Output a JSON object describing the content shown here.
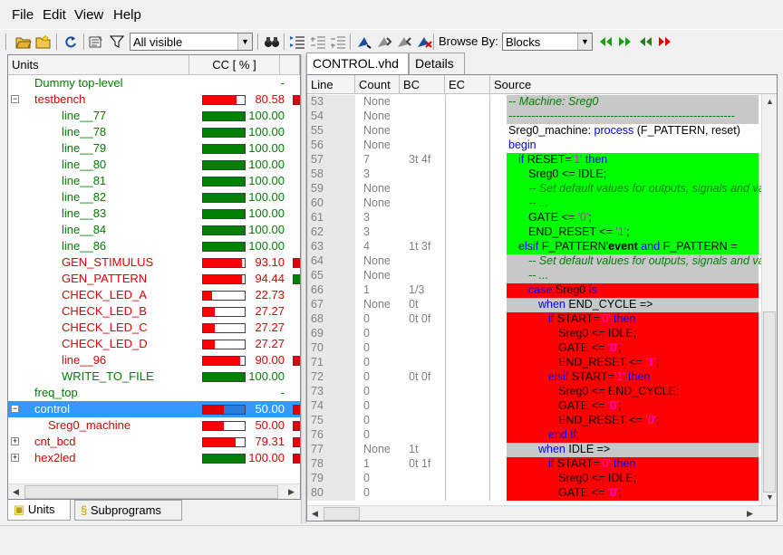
{
  "menu": [
    "File",
    "Edit",
    "View",
    "Help"
  ],
  "toolbar": {
    "filter_value": "All visible",
    "browse_by_label": "Browse By:",
    "browse_by_value": "Blocks"
  },
  "left": {
    "col_units": "Units",
    "col_cc": "CC [ % ]",
    "rows": [
      {
        "name": "Dummy top-level",
        "indent": 0,
        "expander": "",
        "color": "green",
        "pct": "-",
        "fill": 0,
        "fill_color": "",
        "mini": ""
      },
      {
        "name": "testbench",
        "indent": 0,
        "expander": "-",
        "color": "red",
        "pct": "80.58",
        "fill": 0.8058,
        "fill_color": "red",
        "mini": "#e00000"
      },
      {
        "name": "line__77",
        "indent": 2,
        "expander": "",
        "color": "green",
        "pct": "100.00",
        "fill": 1,
        "fill_color": "green",
        "mini": ""
      },
      {
        "name": "line__78",
        "indent": 2,
        "expander": "",
        "color": "green",
        "pct": "100.00",
        "fill": 1,
        "fill_color": "green",
        "mini": ""
      },
      {
        "name": "line__79",
        "indent": 2,
        "expander": "",
        "color": "green",
        "pct": "100.00",
        "fill": 1,
        "fill_color": "green",
        "mini": ""
      },
      {
        "name": "line__80",
        "indent": 2,
        "expander": "",
        "color": "green",
        "pct": "100.00",
        "fill": 1,
        "fill_color": "green",
        "mini": ""
      },
      {
        "name": "line__81",
        "indent": 2,
        "expander": "",
        "color": "green",
        "pct": "100.00",
        "fill": 1,
        "fill_color": "green",
        "mini": ""
      },
      {
        "name": "line__82",
        "indent": 2,
        "expander": "",
        "color": "green",
        "pct": "100.00",
        "fill": 1,
        "fill_color": "green",
        "mini": ""
      },
      {
        "name": "line__83",
        "indent": 2,
        "expander": "",
        "color": "green",
        "pct": "100.00",
        "fill": 1,
        "fill_color": "green",
        "mini": ""
      },
      {
        "name": "line__84",
        "indent": 2,
        "expander": "",
        "color": "green",
        "pct": "100.00",
        "fill": 1,
        "fill_color": "green",
        "mini": ""
      },
      {
        "name": "line__86",
        "indent": 2,
        "expander": "",
        "color": "green",
        "pct": "100.00",
        "fill": 1,
        "fill_color": "green",
        "mini": ""
      },
      {
        "name": "GEN_STIMULUS",
        "indent": 2,
        "expander": "",
        "color": "red",
        "pct": "93.10",
        "fill": 0.931,
        "fill_color": "red",
        "mini": "#e00000"
      },
      {
        "name": "GEN_PATTERN",
        "indent": 2,
        "expander": "",
        "color": "red",
        "pct": "94.44",
        "fill": 0.9444,
        "fill_color": "red",
        "mini": "#008000"
      },
      {
        "name": "CHECK_LED_A",
        "indent": 2,
        "expander": "",
        "color": "red",
        "pct": "22.73",
        "fill": 0.2273,
        "fill_color": "red",
        "mini": ""
      },
      {
        "name": "CHECK_LED_B",
        "indent": 2,
        "expander": "",
        "color": "red",
        "pct": "27.27",
        "fill": 0.2727,
        "fill_color": "red",
        "mini": ""
      },
      {
        "name": "CHECK_LED_C",
        "indent": 2,
        "expander": "",
        "color": "red",
        "pct": "27.27",
        "fill": 0.2727,
        "fill_color": "red",
        "mini": ""
      },
      {
        "name": "CHECK_LED_D",
        "indent": 2,
        "expander": "",
        "color": "red",
        "pct": "27.27",
        "fill": 0.2727,
        "fill_color": "red",
        "mini": ""
      },
      {
        "name": "line__96",
        "indent": 2,
        "expander": "",
        "color": "red",
        "pct": "90.00",
        "fill": 0.9,
        "fill_color": "red",
        "mini": "#e00000"
      },
      {
        "name": "WRITE_TO_FILE",
        "indent": 2,
        "expander": "",
        "color": "green",
        "pct": "100.00",
        "fill": 1,
        "fill_color": "green",
        "mini": ""
      },
      {
        "name": "freq_top",
        "indent": 0,
        "expander": "",
        "color": "green",
        "pct": "-",
        "fill": 0,
        "fill_color": "",
        "mini": ""
      },
      {
        "name": "control",
        "indent": 0,
        "expander": "-",
        "color": "red",
        "pct": "50.00",
        "fill": 0.5,
        "fill_color": "red",
        "mini": "#e00000",
        "selected": true
      },
      {
        "name": "Sreg0_machine",
        "indent": 1,
        "expander": "",
        "color": "red",
        "pct": "50.00",
        "fill": 0.5,
        "fill_color": "red",
        "mini": "#e00000"
      },
      {
        "name": "cnt_bcd",
        "indent": 0,
        "expander": "+",
        "color": "red",
        "pct": "79.31",
        "fill": 0.7931,
        "fill_color": "red",
        "mini": "#e00000"
      },
      {
        "name": "hex2led",
        "indent": 0,
        "expander": "+",
        "color": "red",
        "pct": "100.00",
        "fill": 1,
        "fill_color": "green",
        "mini": "#e00000"
      }
    ],
    "tabs": [
      "Units",
      "Subprograms"
    ]
  },
  "right": {
    "tabs": [
      "CONTROL.vhd",
      "Details"
    ],
    "headers": {
      "line": "Line",
      "count": "Count",
      "bc": "BC",
      "ec": "EC",
      "source": "Source"
    },
    "rows": [
      {
        "line": "53",
        "count": "None",
        "bc": "",
        "bg": "gray",
        "indent": 0,
        "parts": [
          {
            "t": "-- Machine: Sreg0",
            "c": "cmt"
          }
        ]
      },
      {
        "line": "54",
        "count": "None",
        "bc": "",
        "bg": "gray",
        "indent": 0,
        "parts": [
          {
            "t": "------------------------------------------------------------",
            "c": "cmt"
          }
        ]
      },
      {
        "line": "55",
        "count": "None",
        "bc": "",
        "bg": "white",
        "indent": 0,
        "parts": [
          {
            "t": "Sreg0_machine: ",
            "c": "n"
          },
          {
            "t": "process",
            "c": "kw"
          },
          {
            "t": " (F_PATTERN, reset)",
            "c": "n"
          }
        ]
      },
      {
        "line": "56",
        "count": "None",
        "bc": "",
        "bg": "white",
        "indent": 0,
        "parts": [
          {
            "t": "begin",
            "c": "kw"
          }
        ]
      },
      {
        "line": "57",
        "count": "7",
        "bc": "3t 4f",
        "bg": "green",
        "indent": 1,
        "parts": [
          {
            "t": "if",
            "c": "kw"
          },
          {
            "t": " RESET=",
            "c": "n"
          },
          {
            "t": "'1'",
            "c": "str"
          },
          {
            "t": " then",
            "c": "kw"
          }
        ]
      },
      {
        "line": "58",
        "count": "3",
        "bc": "",
        "bg": "green",
        "indent": 2,
        "parts": [
          {
            "t": "Sreg0 <= IDLE;",
            "c": "n"
          }
        ]
      },
      {
        "line": "59",
        "count": "None",
        "bc": "",
        "bg": "green",
        "indent": 2,
        "parts": [
          {
            "t": "-- Set default values for outputs, signals and variables",
            "c": "cmt"
          }
        ]
      },
      {
        "line": "60",
        "count": "None",
        "bc": "",
        "bg": "green",
        "indent": 2,
        "parts": [
          {
            "t": "-- ...",
            "c": "cmt"
          }
        ]
      },
      {
        "line": "61",
        "count": "3",
        "bc": "",
        "bg": "green",
        "indent": 2,
        "parts": [
          {
            "t": "GATE <= ",
            "c": "n"
          },
          {
            "t": "'0'",
            "c": "str"
          },
          {
            "t": ";",
            "c": "n"
          }
        ]
      },
      {
        "line": "62",
        "count": "3",
        "bc": "",
        "bg": "green",
        "indent": 2,
        "parts": [
          {
            "t": "END_RESET <= ",
            "c": "n"
          },
          {
            "t": "'1'",
            "c": "str"
          },
          {
            "t": ";",
            "c": "n"
          }
        ]
      },
      {
        "line": "63",
        "count": "4",
        "bc": "1t 3f",
        "bg": "green",
        "indent": 1,
        "parts": [
          {
            "t": "elsif",
            "c": "kw"
          },
          {
            "t": " F_PATTERN'",
            "c": "n"
          },
          {
            "t": "event",
            "c": "b"
          },
          {
            "t": " and",
            "c": "kw"
          },
          {
            "t": " F_PATTERN = ",
            "c": "n"
          }
        ]
      },
      {
        "line": "64",
        "count": "None",
        "bc": "",
        "bg": "gray",
        "indent": 2,
        "parts": [
          {
            "t": "-- Set default values for outputs, signals and variables",
            "c": "cmt"
          }
        ]
      },
      {
        "line": "65",
        "count": "None",
        "bc": "",
        "bg": "gray",
        "indent": 2,
        "parts": [
          {
            "t": "-- ...",
            "c": "cmt"
          }
        ]
      },
      {
        "line": "66",
        "count": "1",
        "bc": "1/3",
        "bg": "red",
        "indent": 2,
        "parts": [
          {
            "t": "case",
            "c": "kw"
          },
          {
            "t": " Sreg0 ",
            "c": "n"
          },
          {
            "t": "is",
            "c": "kw"
          }
        ]
      },
      {
        "line": "67",
        "count": "None",
        "bc": "0t",
        "bg": "gray",
        "indent": 3,
        "parts": [
          {
            "t": "when",
            "c": "kw"
          },
          {
            "t": " END_CYCLE =>",
            "c": "n"
          }
        ]
      },
      {
        "line": "68",
        "count": "0",
        "bc": "0t 0f",
        "bg": "red",
        "indent": 4,
        "parts": [
          {
            "t": "if",
            "c": "kw"
          },
          {
            "t": " START=",
            "c": "n"
          },
          {
            "t": "'0'",
            "c": "str"
          },
          {
            "t": " then",
            "c": "kw"
          }
        ]
      },
      {
        "line": "69",
        "count": "0",
        "bc": "",
        "bg": "red",
        "indent": 5,
        "parts": [
          {
            "t": "Sreg0 <= IDLE;",
            "c": "n"
          }
        ]
      },
      {
        "line": "70",
        "count": "0",
        "bc": "",
        "bg": "red",
        "indent": 5,
        "parts": [
          {
            "t": "GATE <= ",
            "c": "n"
          },
          {
            "t": "'0'",
            "c": "str"
          },
          {
            "t": ";",
            "c": "n"
          }
        ]
      },
      {
        "line": "71",
        "count": "0",
        "bc": "",
        "bg": "red",
        "indent": 5,
        "parts": [
          {
            "t": "END_RESET <= ",
            "c": "n"
          },
          {
            "t": "'1'",
            "c": "str"
          },
          {
            "t": ";",
            "c": "n"
          }
        ]
      },
      {
        "line": "72",
        "count": "0",
        "bc": "0t 0f",
        "bg": "red",
        "indent": 4,
        "parts": [
          {
            "t": "elsif",
            "c": "kw"
          },
          {
            "t": " START=",
            "c": "n"
          },
          {
            "t": "'1'",
            "c": "str"
          },
          {
            "t": " then",
            "c": "kw"
          }
        ]
      },
      {
        "line": "73",
        "count": "0",
        "bc": "",
        "bg": "red",
        "indent": 5,
        "parts": [
          {
            "t": "Sreg0 <= END_CYCLE;",
            "c": "n"
          }
        ]
      },
      {
        "line": "74",
        "count": "0",
        "bc": "",
        "bg": "red",
        "indent": 5,
        "parts": [
          {
            "t": "GATE <= ",
            "c": "n"
          },
          {
            "t": "'0'",
            "c": "str"
          },
          {
            "t": ";",
            "c": "n"
          }
        ]
      },
      {
        "line": "75",
        "count": "0",
        "bc": "",
        "bg": "red",
        "indent": 5,
        "parts": [
          {
            "t": "END_RESET <= ",
            "c": "n"
          },
          {
            "t": "'0'",
            "c": "str"
          },
          {
            "t": ";",
            "c": "n"
          }
        ]
      },
      {
        "line": "76",
        "count": "0",
        "bc": "",
        "bg": "red",
        "indent": 4,
        "parts": [
          {
            "t": "end if",
            "c": "kw"
          },
          {
            "t": ";",
            "c": "n"
          }
        ]
      },
      {
        "line": "77",
        "count": "None",
        "bc": "1t",
        "bg": "gray",
        "indent": 3,
        "parts": [
          {
            "t": "when",
            "c": "kw"
          },
          {
            "t": " IDLE =>",
            "c": "n"
          }
        ]
      },
      {
        "line": "78",
        "count": "1",
        "bc": "0t 1f",
        "bg": "red",
        "indent": 4,
        "parts": [
          {
            "t": "if",
            "c": "kw"
          },
          {
            "t": " START=",
            "c": "n"
          },
          {
            "t": "'0'",
            "c": "str"
          },
          {
            "t": " then",
            "c": "kw"
          }
        ]
      },
      {
        "line": "79",
        "count": "0",
        "bc": "",
        "bg": "red",
        "indent": 5,
        "parts": [
          {
            "t": "Sreg0 <= IDLE;",
            "c": "n"
          }
        ]
      },
      {
        "line": "80",
        "count": "0",
        "bc": "",
        "bg": "red",
        "indent": 5,
        "parts": [
          {
            "t": "GATE <= ",
            "c": "n"
          },
          {
            "t": "'0'",
            "c": "str"
          },
          {
            "t": ";",
            "c": "n"
          }
        ]
      }
    ]
  },
  "colors": {
    "covered": "#00ff00",
    "uncovered": "#ff0000",
    "neutral": "#c8c8c8",
    "keyword": "#0000ff",
    "comment": "#008000",
    "selection": "#3399ff"
  }
}
